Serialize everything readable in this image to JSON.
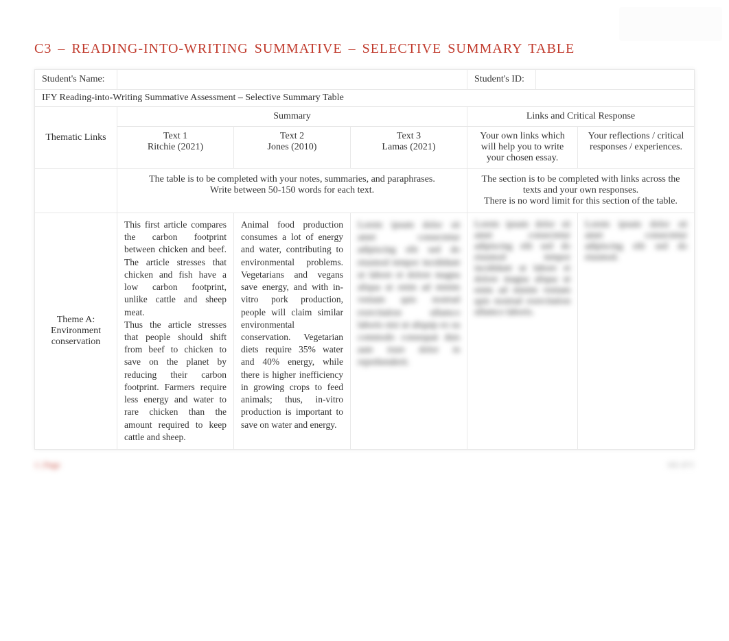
{
  "title": "C3 – READING-INTO-WRITING SUMMATIVE – SELECTIVE SUMMARY TABLE",
  "studentRow": {
    "nameLabel": "Student's Name:",
    "nameValue": "",
    "idLabel": "Student's ID:",
    "idValue": ""
  },
  "assessmentLine": "IFY Reading-into-Writing Summative Assessment – Selective Summary Table",
  "headers": {
    "thematicLinks": "Thematic Links",
    "summary": "Summary",
    "linksCritical": "Links and Critical Response"
  },
  "texts": {
    "text1Label": "Text 1",
    "text1Author": "Ritchie (2021)",
    "text2Label": "Text 2",
    "text2Author": "Jones (2010)",
    "text3Label": "Text 3",
    "text3Author": "Lamas (2021)"
  },
  "subheaders": {
    "ownLinks": "Your own links which will help you to write your chosen essay.",
    "reflections": "Your reflections / critical responses / experiences."
  },
  "instructions": {
    "summaryInstr": "The table is to be completed with your notes, summaries, and paraphrases.\nWrite between 50-150 words for each text.",
    "linksInstr": "The section is to be completed with links across the texts and your own responses.\nThere is no word limit for this section of the table."
  },
  "themeA": {
    "label": "Theme A: Environment conservation",
    "text1Content": "This first article compares the carbon footprint between chicken and beef. The article stresses that chicken and fish have a low carbon footprint, unlike cattle and sheep meat.\nThus the article stresses that people should shift from beef to chicken to save on the planet by reducing their carbon footprint. Farmers require less energy and water to rare chicken than the amount required to keep cattle and sheep.",
    "text2Content": "Animal food production consumes a lot of energy and water, contributing to environmental problems. Vegetarians and vegans save energy, and with in-vitro pork production, people will claim similar environmental conservation. Vegetarian diets require 35% water and 40% energy, while there is higher inefficiency in growing crops to feed animals; thus, in-vitro production is important to save on water and energy.",
    "text3Blurred": "Lorem ipsum dolor sit amet consectetur adipiscing elit sed do eiusmod tempor incididunt ut labore et dolore magna aliqua ut enim ad minim veniam quis nostrud exercitation ullamco laboris nisi ut aliquip ex ea commodo consequat duis aute irure dolor in reprehenderit.",
    "linksBlurred": "Lorem ipsum dolor sit amet consectetur adipiscing elit sed do eiusmod tempor incididunt ut labore et dolore magna aliqua ut enim ad minim veniam quis nostrud exercitation ullamco laboris.",
    "reflectionsBlurred": "Lorem ipsum dolor sit amet consectetur adipiscing elit sed do eiusmod."
  },
  "footer": {
    "left": "1 | Page",
    "right": "HE-IFY"
  }
}
